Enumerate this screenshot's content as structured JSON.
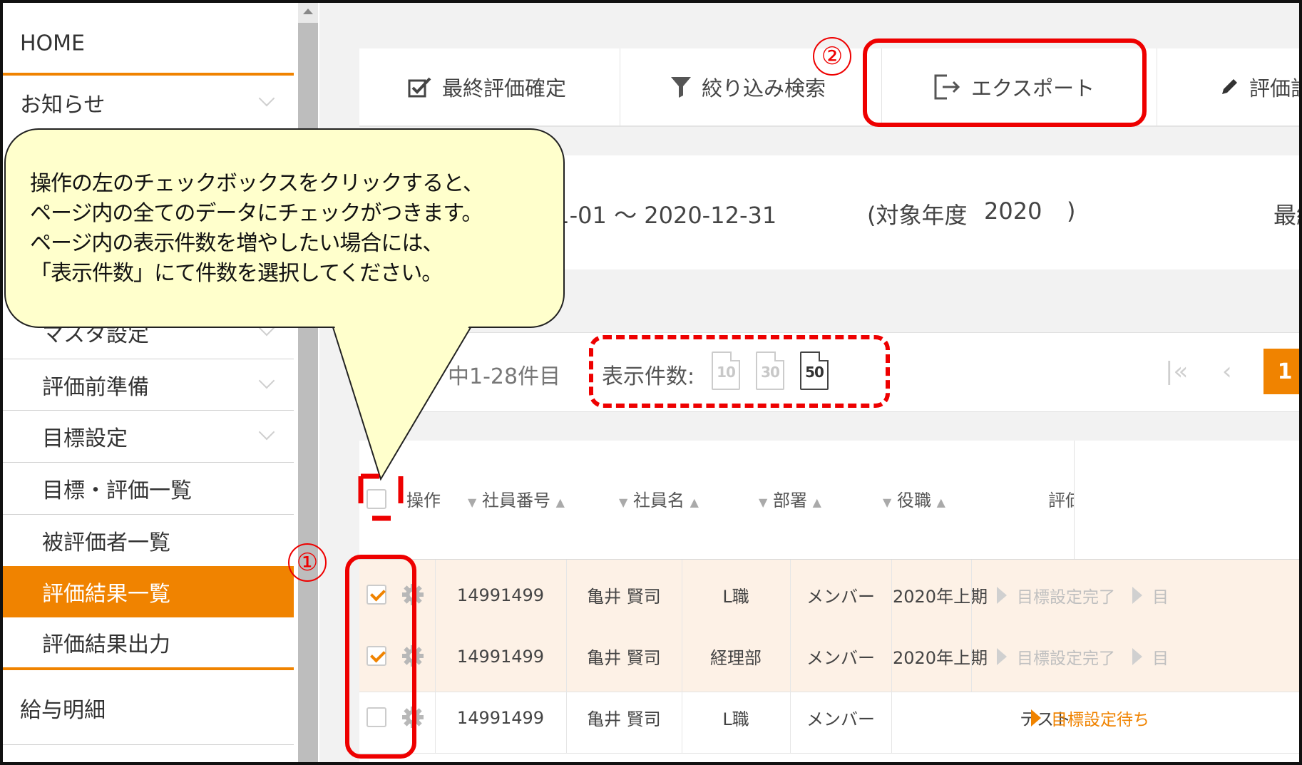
{
  "sidebar": {
    "home": "HOME",
    "notice": "お知らせ",
    "master": "マスタ設定",
    "prep": "評価前準備",
    "goal": "目標設定",
    "goal_eval_list": "目標・評価一覧",
    "evaluee_list": "被評価者一覧",
    "result_list": "評価結果一覧",
    "result_output": "評価結果出力",
    "payslip": "給与明細"
  },
  "toolbar": {
    "final_confirm": "最終評価確定",
    "filter": "絞り込み検索",
    "export": "エクスポート",
    "edit": "評価設"
  },
  "period": {
    "range": "0-01-01 ～ 2020-12-31",
    "fiscal_label": "(対象年度",
    "fiscal_year": "2020",
    "fiscal_close": ")",
    "right": "最終"
  },
  "pager": {
    "count_text": "中1-28件目",
    "per_page_label": "表示件数:",
    "options": [
      "10",
      "30",
      "50"
    ],
    "selected": "50",
    "first": "|«",
    "prev": "‹",
    "current_page": "1"
  },
  "table": {
    "headers": {
      "action": "操作",
      "emp_no": "社員番号",
      "emp_name": "社員名",
      "dept": "部署",
      "position": "役職",
      "eval": "評価"
    },
    "rows": [
      {
        "checked": true,
        "emp_no": "14991499",
        "name": "亀井 賢司",
        "dept": "L職",
        "position": "メンバー",
        "period": "2020年上期",
        "status": "目標設定完了",
        "status_style": "gray",
        "next": "目"
      },
      {
        "checked": true,
        "emp_no": "14991499",
        "name": "亀井 賢司",
        "dept": "経理部",
        "position": "メンバー",
        "period": "2020年上期",
        "status": "目標設定完了",
        "status_style": "gray",
        "next": "目"
      },
      {
        "checked": false,
        "emp_no": "14991499",
        "name": "亀井 賢司",
        "dept": "L職",
        "position": "メンバー",
        "period": "テスト",
        "status": "目標設定待ち",
        "status_style": "orange",
        "next": ""
      }
    ]
  },
  "callout": {
    "lines": [
      "操作の左のチェックボックスをクリックすると、",
      "ページ内の全てのデータにチェックがつきます。",
      "ページ内の表示件数を増やしたい場合には、",
      "「表示件数」にて件数を選択してください。"
    ]
  },
  "annotations": {
    "marker1": "①",
    "marker2": "②"
  },
  "colors": {
    "accent": "#f08300",
    "annotation": "#ee0000",
    "callout_bg": "#ffffcc"
  }
}
